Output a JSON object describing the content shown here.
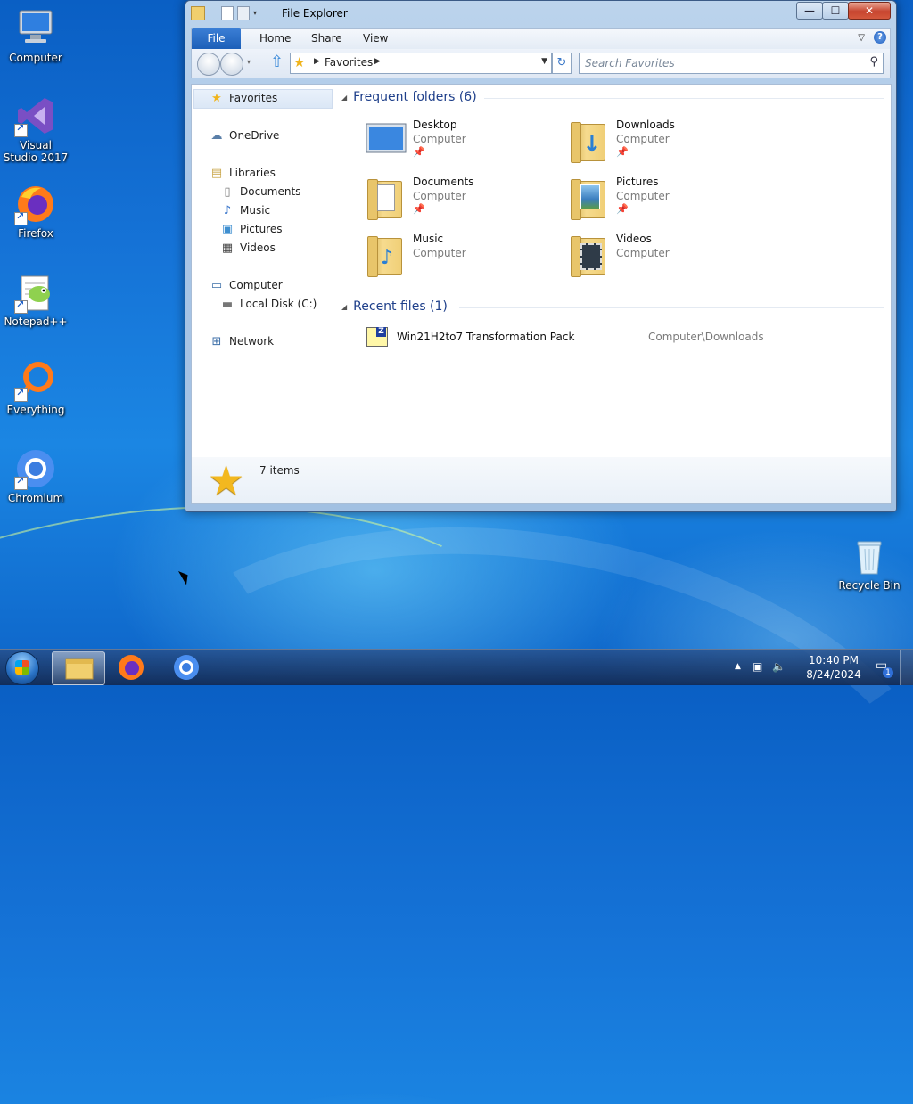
{
  "desktop": {
    "icons": [
      {
        "label": "Computer"
      },
      {
        "label": "Visual Studio 2017"
      },
      {
        "label": "Firefox"
      },
      {
        "label": "Notepad++"
      },
      {
        "label": "Everything"
      },
      {
        "label": "Chromium"
      },
      {
        "label": "Recycle Bin"
      }
    ]
  },
  "window": {
    "title": "File Explorer",
    "caption": {
      "minimize": "—",
      "maximize": "☐",
      "close": "✕"
    },
    "ribbon_tabs": [
      "File",
      "Home",
      "Share",
      "View"
    ],
    "help": "?",
    "address": {
      "crumb": "Favorites"
    },
    "search": {
      "placeholder": "Search Favorites"
    },
    "nav": {
      "favorites": "Favorites",
      "onedrive": "OneDrive",
      "libraries": "Libraries",
      "documents": "Documents",
      "music": "Music",
      "pictures": "Pictures",
      "videos": "Videos",
      "computer": "Computer",
      "local_disk": "Local Disk (C:)",
      "network": "Network"
    },
    "frequent_header": "Frequent folders (6)",
    "frequent": [
      {
        "name": "Desktop",
        "location": "Computer",
        "pinned": true
      },
      {
        "name": "Downloads",
        "location": "Computer",
        "pinned": true
      },
      {
        "name": "Documents",
        "location": "Computer",
        "pinned": true
      },
      {
        "name": "Pictures",
        "location": "Computer",
        "pinned": true
      },
      {
        "name": "Music",
        "location": "Computer",
        "pinned": false
      },
      {
        "name": "Videos",
        "location": "Computer",
        "pinned": false
      }
    ],
    "recent_header": "Recent files (1)",
    "recent": [
      {
        "name": "Win21H2to7 Transformation Pack",
        "path": "Computer\\Downloads"
      }
    ],
    "status": {
      "count": "7 items"
    }
  },
  "taskbar": {
    "clock": {
      "time": "10:40 PM",
      "date": "8/24/2024"
    },
    "notification_count": "1"
  }
}
